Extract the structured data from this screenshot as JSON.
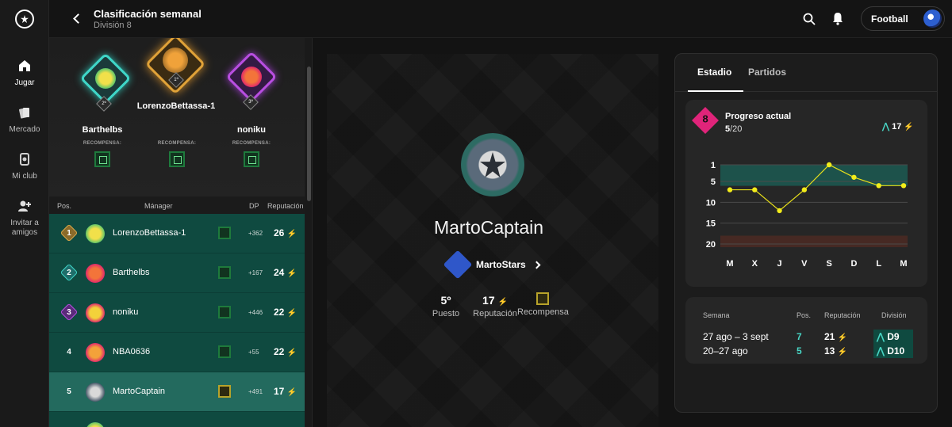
{
  "nav": {
    "logo": "app-logo",
    "items": [
      {
        "label": "Jugar",
        "icon": "home-icon"
      },
      {
        "label": "Mercado",
        "icon": "cards-icon"
      },
      {
        "label": "Mi club",
        "icon": "club-icon"
      },
      {
        "label": "Invitar a amigos",
        "icon": "add-person-icon"
      }
    ]
  },
  "header": {
    "title": "Clasificación semanal",
    "subtitle": "División 8",
    "account_label": "Football"
  },
  "podium": {
    "first": {
      "name": "LorenzoBettassa-1",
      "rank": "1º"
    },
    "second": {
      "name": "Barthelbs",
      "rank": "2º"
    },
    "third": {
      "name": "noniku",
      "rank": "3º"
    },
    "reward_label": "RECOMPENSA:"
  },
  "table": {
    "headers": {
      "pos": "Pos.",
      "manager": "Mánager",
      "dp": "DP",
      "rep": "Reputación"
    },
    "rows": [
      {
        "pos": "1",
        "name": "LorenzoBettassa-1",
        "dp": "+362",
        "rep": "26"
      },
      {
        "pos": "2",
        "name": "Barthelbs",
        "dp": "+167",
        "rep": "24"
      },
      {
        "pos": "3",
        "name": "noniku",
        "dp": "+446",
        "rep": "22"
      },
      {
        "pos": "4",
        "name": "NBA0636",
        "dp": "+55",
        "rep": "22"
      },
      {
        "pos": "5",
        "name": "MartoCaptain",
        "dp": "+491",
        "rep": "17"
      }
    ]
  },
  "profile": {
    "name": "MartoCaptain",
    "club": "MartoStars",
    "stats": {
      "puesto_value": "5º",
      "puesto_label": "Puesto",
      "rep_value": "17",
      "rep_label": "Reputación",
      "reward_label": "Recompensa"
    }
  },
  "right": {
    "tabs": [
      "Estadio",
      "Partidos"
    ],
    "progress": {
      "division_badge": "8",
      "title": "Progreso actual",
      "current": "5",
      "total": "/20",
      "rep": "17"
    },
    "chart_data": {
      "type": "line",
      "categories": [
        "M",
        "X",
        "J",
        "V",
        "S",
        "D",
        "L",
        "M"
      ],
      "values": [
        7,
        7,
        12,
        7,
        1,
        4,
        6,
        6
      ],
      "yticks": [
        "1",
        "5",
        "10",
        "15",
        "20"
      ],
      "ylim": [
        1,
        20
      ],
      "invert_y": true,
      "promotion_zone": [
        1,
        7
      ],
      "relegation_zone": [
        18,
        20
      ]
    },
    "history": {
      "headers": {
        "week": "Semana",
        "pos": "Pos.",
        "rep": "Reputación",
        "div": "División"
      },
      "rows": [
        {
          "week": "27 ago – 3 sept",
          "pos": "7",
          "rep": "21",
          "div": "D9"
        },
        {
          "week": "20–27 ago",
          "pos": "5",
          "rep": "13",
          "div": "D10"
        }
      ]
    }
  },
  "colors": {
    "teal_row": "#0f4a40",
    "highlight_row": "#236a5e",
    "bolt": "#e8e01a",
    "accent_up": "#48d6c5",
    "club": "#2f57c9"
  }
}
